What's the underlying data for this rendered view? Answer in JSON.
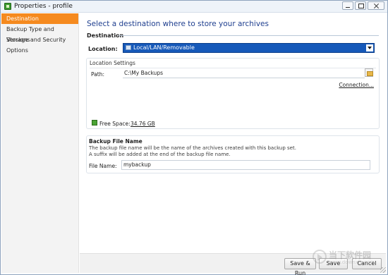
{
  "window": {
    "title": "Properties - profile"
  },
  "nav": {
    "items": [
      {
        "label": "Destination",
        "active": true
      },
      {
        "label": "Backup Type and Versions",
        "active": false
      },
      {
        "label": "Storage and Security",
        "active": false
      },
      {
        "label": "Options",
        "active": false
      }
    ]
  },
  "main": {
    "heading": "Select a destination where to store your archives",
    "destination_section": "Destination",
    "location_label": "Location:",
    "location_value": "Local/LAN/Removable",
    "location_settings_title": "Location Settings",
    "path_label": "Path:",
    "path_value": "C:\\My Backups",
    "connection_link": "Connection...",
    "free_space_label": "Free Space:",
    "free_space_value": "34.76 GB",
    "backup_file_name_title": "Backup File Name",
    "backup_file_desc_1": "The backup file name will be the name of the archives created with this backup set.",
    "backup_file_desc_2": "A suffix will be added at the end of the backup file name.",
    "file_name_label": "File Name:",
    "file_name_value": "mybackup"
  },
  "footer": {
    "save_run": "Save & Run",
    "save": "Save",
    "cancel": "Cancel"
  },
  "watermark": {
    "text": "当下软件园",
    "sub": "www.downxia.com"
  },
  "colors": {
    "accent_active": "#f58a1f",
    "heading_blue": "#1f3f8f",
    "select_blue": "#1659b9",
    "free_space_green": "#4aa334"
  }
}
